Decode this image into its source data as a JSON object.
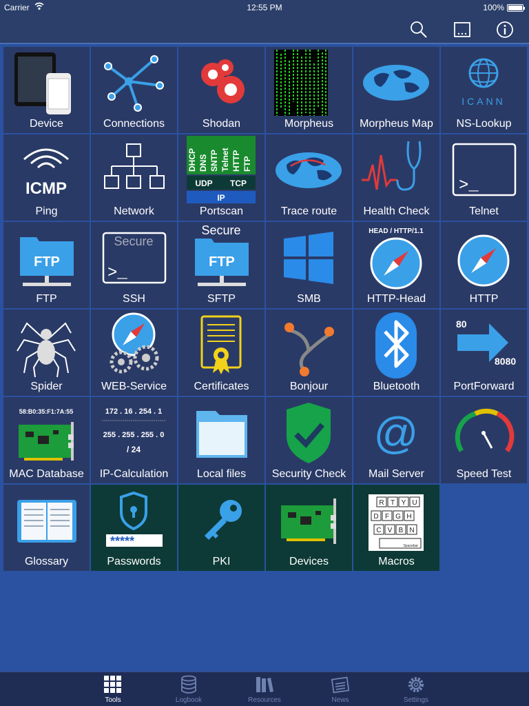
{
  "status": {
    "carrier": "Carrier",
    "time": "12:55 PM",
    "battery": "100%"
  },
  "nav": {
    "icons": [
      "search-icon",
      "ellipsis-icon",
      "info-icon"
    ]
  },
  "tiles": [
    {
      "id": "device",
      "label": "Device"
    },
    {
      "id": "connections",
      "label": "Connections"
    },
    {
      "id": "shodan",
      "label": "Shodan"
    },
    {
      "id": "morpheus",
      "label": "Morpheus"
    },
    {
      "id": "morpheus-map",
      "label": "Morpheus Map"
    },
    {
      "id": "ns-lookup",
      "label": "NS-Lookup",
      "logo_text": "ICANN"
    },
    {
      "id": "ping",
      "label": "Ping",
      "icon_text": "ICMP"
    },
    {
      "id": "network",
      "label": "Network"
    },
    {
      "id": "portscan",
      "label": "Portscan",
      "protocols": [
        "DHCP",
        "DNS",
        "SNTP",
        "Telnet",
        "HTTP",
        "FTP"
      ],
      "transports": [
        "UDP",
        "TCP"
      ],
      "layer": "IP"
    },
    {
      "id": "trace-route",
      "label": "Trace route"
    },
    {
      "id": "health-check",
      "label": "Health Check"
    },
    {
      "id": "telnet",
      "label": "Telnet",
      "prompt": ">_"
    },
    {
      "id": "ftp",
      "label": "FTP",
      "icon_text": "FTP"
    },
    {
      "id": "ssh",
      "label": "SSH",
      "icon_text": "Secure",
      "prompt": ">_"
    },
    {
      "id": "sftp",
      "label": "SFTP",
      "icon_text": "FTP",
      "top_text": "Secure"
    },
    {
      "id": "smb",
      "label": "SMB"
    },
    {
      "id": "http-head",
      "label": "HTTP-Head",
      "top_text": "HEAD / HTTP/1.1"
    },
    {
      "id": "http",
      "label": "HTTP"
    },
    {
      "id": "spider",
      "label": "Spider"
    },
    {
      "id": "web-service",
      "label": "WEB-Service"
    },
    {
      "id": "certificates",
      "label": "Certificates"
    },
    {
      "id": "bonjour",
      "label": "Bonjour"
    },
    {
      "id": "bluetooth",
      "label": "Bluetooth"
    },
    {
      "id": "portforward",
      "label": "PortForward",
      "from_port": "80",
      "to_port": "8080"
    },
    {
      "id": "mac-database",
      "label": "MAC Database",
      "mac": "58:B0:35:F1:7A:55"
    },
    {
      "id": "ip-calculation",
      "label": "IP-Calculation",
      "ip": "172 . 16 . 254 . 1",
      "mask": "255 . 255 . 255 . 0",
      "cidr": "/ 24"
    },
    {
      "id": "local-files",
      "label": "Local files"
    },
    {
      "id": "security-check",
      "label": "Security Check"
    },
    {
      "id": "mail-server",
      "label": "Mail Server",
      "icon_text": "@"
    },
    {
      "id": "speed-test",
      "label": "Speed Test"
    },
    {
      "id": "glossary",
      "label": "Glossary"
    },
    {
      "id": "passwords",
      "label": "Passwords",
      "icon_text": "*****"
    },
    {
      "id": "pki",
      "label": "PKI"
    },
    {
      "id": "devices",
      "label": "Devices"
    },
    {
      "id": "macros",
      "label": "Macros",
      "keys": [
        "R",
        "T",
        "Y",
        "U",
        "D",
        "F",
        "G",
        "H",
        "C",
        "V",
        "B",
        "N"
      ],
      "space_label": "Spacebar"
    }
  ],
  "tabs": [
    {
      "label": "Tools",
      "icon": "grid-icon",
      "active": true
    },
    {
      "label": "Logbook",
      "icon": "database-icon",
      "active": false
    },
    {
      "label": "Resources",
      "icon": "books-icon",
      "active": false
    },
    {
      "label": "News",
      "icon": "newspaper-icon",
      "active": false
    },
    {
      "label": "Settings",
      "icon": "gear-icon",
      "active": false
    }
  ],
  "colors": {
    "background": "#2a52a0",
    "tile": "#2a3a66",
    "tile_dark": "#0d3a36",
    "accent": "#3aa0e8",
    "nav": "#2b3f6a"
  }
}
